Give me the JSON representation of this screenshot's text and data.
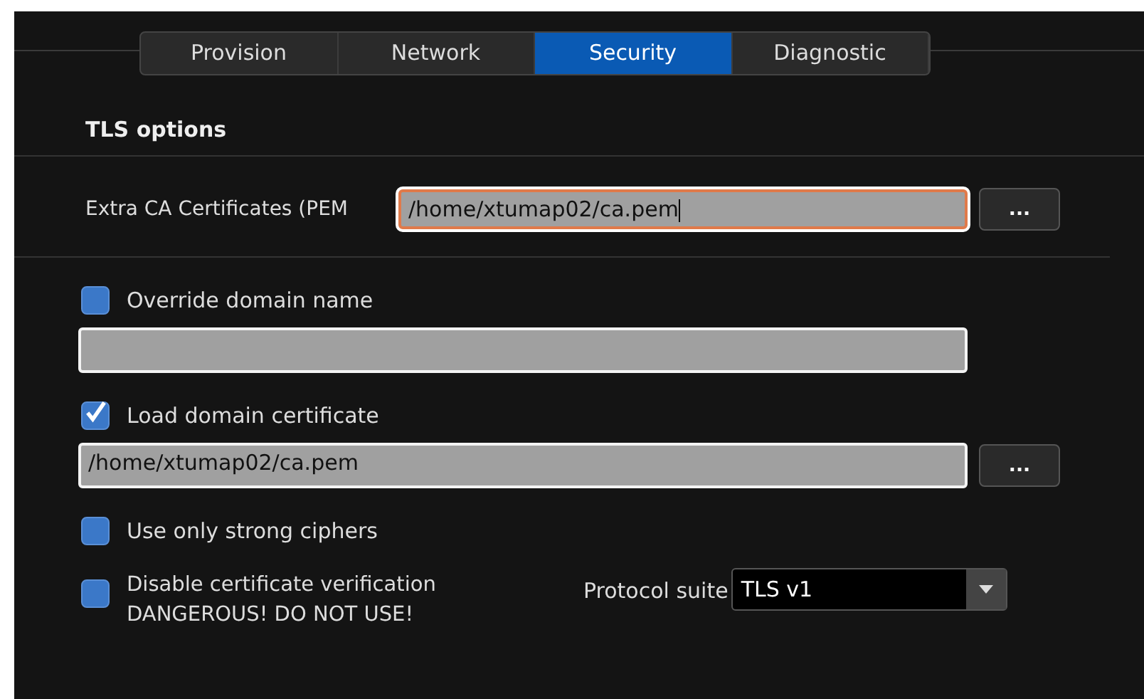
{
  "tabs": [
    {
      "label": "Provision",
      "selected": false
    },
    {
      "label": "Network",
      "selected": false
    },
    {
      "label": "Security",
      "selected": true
    },
    {
      "label": "Diagnostic",
      "selected": false
    }
  ],
  "section_title": "TLS options",
  "extra_ca": {
    "label": "Extra CA Certificates (PEM",
    "value": "/home/xtumap02/ca.pem",
    "focused": true,
    "button": "..."
  },
  "rows": [
    {
      "kind": "checkbox",
      "label": "Override domain name",
      "checked": false
    },
    {
      "kind": "field",
      "value": ""
    },
    {
      "kind": "checkbox",
      "label": "Load domain certificate",
      "checked": true
    },
    {
      "kind": "field",
      "value": "/home/xtumap02/ca.pem",
      "button": "..."
    },
    {
      "kind": "checkbox",
      "label": "Use only strong ciphers",
      "checked": false
    }
  ],
  "last_option": {
    "label": "Disable certificate verification",
    "note": "DANGEROUS! DO NOT USE!",
    "checked": false
  },
  "protocol": {
    "label": "Protocol suite",
    "value": "TLS v1"
  }
}
